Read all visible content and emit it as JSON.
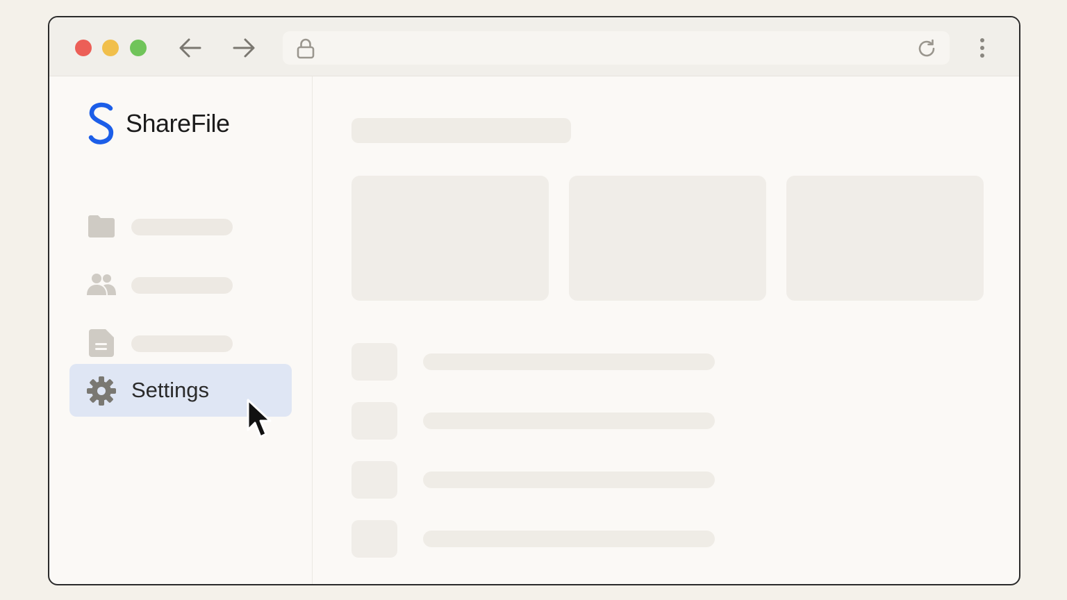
{
  "browser": {
    "traffic_lights": {
      "close_color": "#ec5f57",
      "minimize_color": "#f1bf4b",
      "maximize_color": "#70c45a"
    },
    "back_icon": "arrow-left-icon",
    "forward_icon": "arrow-right-icon",
    "address_bar": {
      "lock_icon": "lock-icon",
      "value": ""
    },
    "reload_icon": "reload-icon",
    "menu_icon": "kebab-menu-icon"
  },
  "sidebar": {
    "brand": {
      "name": "ShareFile",
      "logo_color": "#1c5ee8"
    },
    "items": [
      {
        "icon": "folder-icon",
        "label": "",
        "active": false
      },
      {
        "icon": "users-icon",
        "label": "",
        "active": false
      },
      {
        "icon": "document-icon",
        "label": "",
        "active": false
      },
      {
        "icon": "gear-icon",
        "label": "Settings",
        "active": true
      }
    ],
    "active_color": "#dfe6f4"
  },
  "main": {
    "cards": [
      {},
      {},
      {}
    ],
    "rows": [
      {},
      {},
      {},
      {}
    ]
  },
  "cursor": {
    "icon": "mouse-pointer-icon"
  }
}
